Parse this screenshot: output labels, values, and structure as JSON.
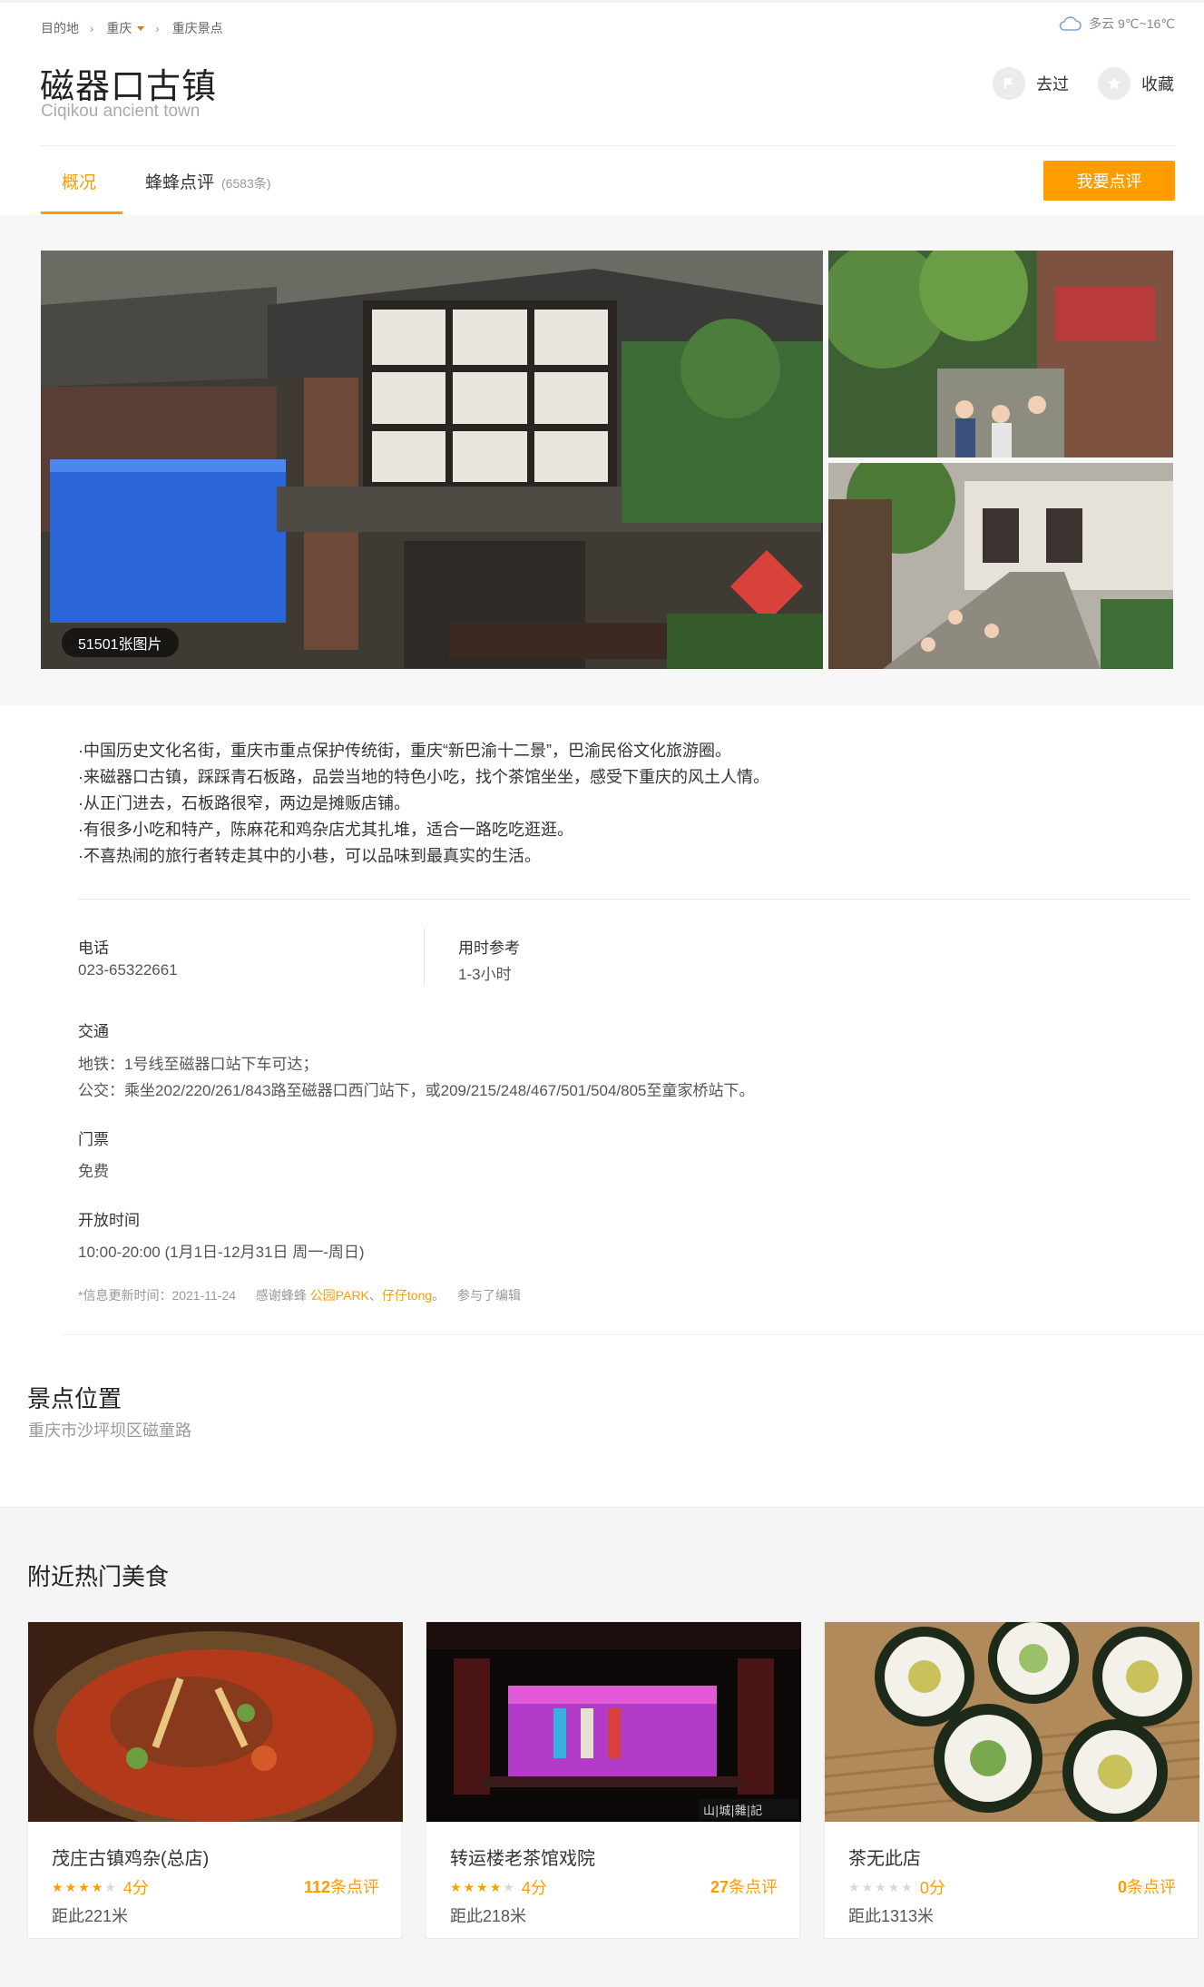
{
  "breadcrumb": {
    "items": [
      "目的地",
      "重庆",
      "重庆景点"
    ]
  },
  "weather": {
    "text": "多云 9℃~16℃",
    "icon": "cloud-icon"
  },
  "header": {
    "title_cn": "磁器口古镇",
    "title_en": "Ciqikou ancient town",
    "been_label": "去过",
    "fav_label": "收藏"
  },
  "tabs": {
    "overview": "概况",
    "reviews": "蜂蜂点评",
    "reviews_count": "(6583条)",
    "write_review": "我要点评"
  },
  "photos": {
    "count_label": "51501张图片"
  },
  "summary": [
    "·中国历史文化名街，重庆市重点保护传统街，重庆“新巴渝十二景”，巴渝民俗文化旅游圈。",
    "·来磁器口古镇，踩踩青石板路，品尝当地的特色小吃，找个茶馆坐坐，感受下重庆的风土人情。",
    "·从正门进去，石板路很窄，两边是摊贩店铺。",
    "·有很多小吃和特产，陈麻花和鸡杂店尤其扎堆，适合一路吃吃逛逛。",
    "·不喜热闹的旅行者转走其中的小巷，可以品味到最真实的生活。"
  ],
  "info": {
    "phone_label": "电话",
    "phone": "023-65322661",
    "time_ref_label": "用时参考",
    "time_ref": "1-3小时",
    "traffic_label": "交通",
    "traffic_metro": "地铁：1号线至磁器口站下车可达；",
    "traffic_bus": "公交：乘坐202/220/261/843路至磁器口西门站下，或209/215/248/467/501/504/805至童家桥站下。",
    "ticket_label": "门票",
    "ticket": "免费",
    "hours_label": "开放时间",
    "hours": "10:00-20:00 (1月1日-12月31日 周一-周日)"
  },
  "update_note": {
    "prefix": "*信息更新时间：2021-11-24",
    "thanks": "感谢蜂蜂",
    "user1": "公园PARK",
    "sep": "、",
    "user2": "仔仔tong",
    "period": "。",
    "suffix": "参与了编辑"
  },
  "location": {
    "title": "景点位置",
    "address": "重庆市沙坪坝区磁童路"
  },
  "food": {
    "title": "附近热门美食",
    "cards": [
      {
        "name": "茂庄古镇鸡杂(总店)",
        "stars": 4,
        "score": "4分",
        "reviews_num": "112",
        "reviews_unit": "条点评",
        "distance_prefix": "距此",
        "distance": "221米"
      },
      {
        "name": "转运楼老茶馆戏院",
        "stars": 4,
        "score": "4分",
        "reviews_num": "27",
        "reviews_unit": "条点评",
        "distance_prefix": "距此",
        "distance": "218米"
      },
      {
        "name": "茶无此店",
        "stars": 0,
        "score": "0分",
        "reviews_num": "0",
        "reviews_unit": "条点评",
        "distance_prefix": "距此",
        "distance": "1313米"
      }
    ]
  },
  "colors": {
    "accent": "#ff9d00",
    "breadcrumb_arrow": "#ff6a00"
  }
}
